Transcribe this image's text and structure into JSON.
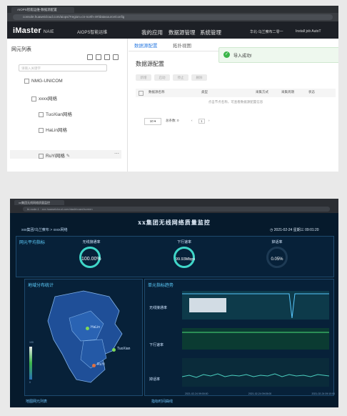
{
  "top": {
    "tab_title": "AIOPS智能运维-数据源配置",
    "address": "console.huaweicloud.com/aiops/?region=cn-north-4#/datasource/config",
    "logo": "iMaster",
    "logo_sub": "NAIE",
    "product": "AIOPS智能运维",
    "menu": [
      "我的应用",
      "数据源管理",
      "系统管理"
    ],
    "region": "华北-乌兰察布二零一",
    "user": "Install job AutoT",
    "left_title": "网元列表",
    "search_placeholder": "请输入关键字",
    "tree": {
      "root": "NMG-UNICOM",
      "group": "xxxx网络",
      "children": [
        "TuoXian网格",
        "HaLin网格",
        "RuYi网格"
      ]
    },
    "right_tabs": [
      "数据源配置",
      "拓扑视图"
    ],
    "right_title": "数据源配置",
    "buttons": [
      "新增",
      "启动",
      "停止",
      "删除"
    ],
    "columns": [
      "数据源名称",
      "类型",
      "采集方式",
      "采集周期",
      "状态"
    ],
    "empty_text": "点击节点名称，可查看数据源配置信息",
    "page_size": "10",
    "total": "总条数: 0",
    "page": "1",
    "toast": "导入成功!"
  },
  "bottom": {
    "tab_title": "xx集团无线网络质量监控",
    "address": "bi-node-1 · xxx.huaweicloud.com/dashboard/screen",
    "title": "xx集团无线网络质量监控",
    "breadcrumb": "xxx集团/乌兰察布 > xxxx网络",
    "time": "2021-02-24 星期三 09:01:20",
    "kpi_title": "网元平均指标",
    "kpis": [
      {
        "label": "无线接通率",
        "value": "100.00%"
      },
      {
        "label": "下行速率",
        "value": "99.93Mbps"
      },
      {
        "label": "掉话率",
        "value": "0.05%"
      }
    ],
    "map_title": "地域分布统计",
    "regions": [
      "HaLin",
      "TuoXian",
      "RuYi"
    ],
    "legend_max": "100",
    "legend_min": "0",
    "trend_title": "单元指标趋势",
    "trend_rows": [
      "无线接通率",
      "下行速率",
      "掉话率"
    ],
    "time_ticks": [
      "2021-02-24 09:00:00",
      "2021-02-24 09:05:00",
      "2021-02-24 09:10:00",
      "2021-02-24 09:15:00",
      "2021-02-24 09:20:00",
      "2021-02-24 09:25:00"
    ],
    "footer_left": "地图网元列表",
    "footer_right": "指标时间曲线"
  },
  "colors": {
    "accent": "#2f7de1",
    "dash_bg": "#061a2c",
    "ring": "#3fd6c8",
    "region_fill": "#1f4f98",
    "halin": "#7ed957",
    "ruyi": "#e07040"
  }
}
